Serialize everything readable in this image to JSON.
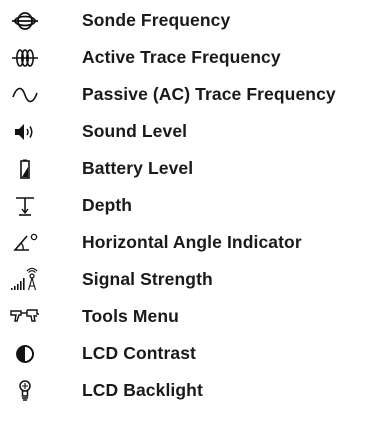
{
  "items": [
    {
      "label": "Sonde Frequency",
      "icon": "sonde-frequency-icon"
    },
    {
      "label": "Active Trace Frequency",
      "icon": "active-trace-frequency-icon"
    },
    {
      "label": "Passive (AC) Trace Frequency",
      "icon": "passive-trace-frequency-icon"
    },
    {
      "label": "Sound Level",
      "icon": "speaker-icon"
    },
    {
      "label": "Battery Level",
      "icon": "battery-icon"
    },
    {
      "label": "Depth",
      "icon": "depth-icon"
    },
    {
      "label": "Horizontal Angle Indicator",
      "icon": "angle-icon"
    },
    {
      "label": "Signal Strength",
      "icon": "signal-strength-icon"
    },
    {
      "label": "Tools Menu",
      "icon": "tools-icon"
    },
    {
      "label": "LCD Contrast",
      "icon": "contrast-icon"
    },
    {
      "label": "LCD Backlight",
      "icon": "backlight-icon"
    }
  ]
}
